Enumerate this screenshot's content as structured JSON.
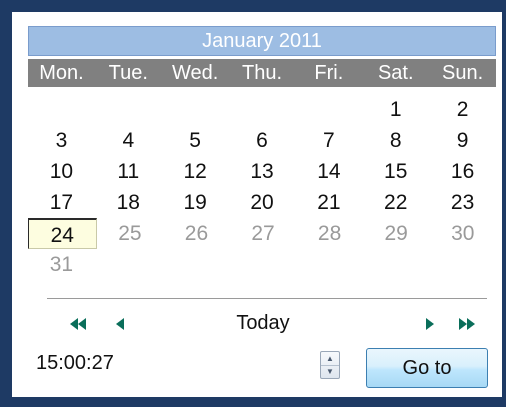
{
  "calendar": {
    "month_title": "January 2011",
    "weekdays": [
      "Mon.",
      "Tue.",
      "Wed.",
      "Thu.",
      "Fri.",
      "Sat.",
      "Sun."
    ],
    "weeks": [
      [
        "",
        "",
        "",
        "",
        "",
        "1",
        "2"
      ],
      [
        "3",
        "4",
        "5",
        "6",
        "7",
        "8",
        "9"
      ],
      [
        "10",
        "11",
        "12",
        "13",
        "14",
        "15",
        "16"
      ],
      [
        "17",
        "18",
        "19",
        "20",
        "21",
        "22",
        "23"
      ],
      [
        "24",
        "25",
        "26",
        "27",
        "28",
        "29",
        "30"
      ],
      [
        "31",
        "",
        "",
        "",
        "",
        "",
        ""
      ]
    ],
    "today_day": "24",
    "dimmed_days": [
      "25",
      "26",
      "27",
      "28",
      "29",
      "30",
      "31"
    ]
  },
  "nav": {
    "prev_year_icon": "double-left-arrow-icon",
    "prev_month_icon": "left-arrow-icon",
    "today_label": "Today",
    "next_month_icon": "right-arrow-icon",
    "next_year_icon": "double-right-arrow-icon",
    "icon_color": "#0a6e5a"
  },
  "time": {
    "value": "15:00:27"
  },
  "goto": {
    "label": "Go to"
  },
  "colors": {
    "background": "#1e3a64",
    "header": "#9dbde3",
    "weekday_bar": "#808080",
    "today_highlight": "#fdfde0"
  }
}
